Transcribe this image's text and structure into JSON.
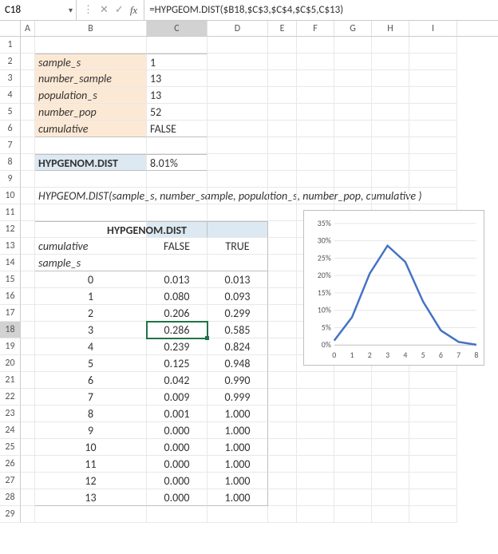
{
  "namebox": "C18",
  "formula": "=HYPGEOM.DIST($B18,$C$3,$C$4,$C$5,C$13)",
  "cols": [
    "A",
    "B",
    "C",
    "D",
    "E",
    "F",
    "G",
    "H",
    "I"
  ],
  "params": {
    "sample_s": {
      "label": "sample_s",
      "value": "1"
    },
    "number_sample": {
      "label": "number_sample",
      "value": "13"
    },
    "population_s": {
      "label": "population_s",
      "value": "13"
    },
    "number_pop": {
      "label": "number_pop",
      "value": "52"
    },
    "cumulative": {
      "label": "cumulative",
      "value": "FALSE"
    }
  },
  "result": {
    "label": "HYPGENOM.DIST",
    "value": "8.01%"
  },
  "syntax": "HYPGEOM.DIST(sample_s, number_sample, population_s, number_pop, cumulative )",
  "table": {
    "header": "HYPGENOM.DIST",
    "row_cum": "cumulative",
    "row_sam": "sample_s",
    "c13": "FALSE",
    "d13": "TRUE",
    "rows": [
      {
        "x": "0",
        "f": "0.013",
        "t": "0.013"
      },
      {
        "x": "1",
        "f": "0.080",
        "t": "0.093"
      },
      {
        "x": "2",
        "f": "0.206",
        "t": "0.299"
      },
      {
        "x": "3",
        "f": "0.286",
        "t": "0.585"
      },
      {
        "x": "4",
        "f": "0.239",
        "t": "0.824"
      },
      {
        "x": "5",
        "f": "0.125",
        "t": "0.948"
      },
      {
        "x": "6",
        "f": "0.042",
        "t": "0.990"
      },
      {
        "x": "7",
        "f": "0.009",
        "t": "0.999"
      },
      {
        "x": "8",
        "f": "0.001",
        "t": "1.000"
      },
      {
        "x": "9",
        "f": "0.000",
        "t": "1.000"
      },
      {
        "x": "10",
        "f": "0.000",
        "t": "1.000"
      },
      {
        "x": "11",
        "f": "0.000",
        "t": "1.000"
      },
      {
        "x": "12",
        "f": "0.000",
        "t": "1.000"
      },
      {
        "x": "13",
        "f": "0.000",
        "t": "1.000"
      }
    ]
  },
  "chart_data": {
    "type": "line",
    "x": [
      0,
      1,
      2,
      3,
      4,
      5,
      6,
      7,
      8
    ],
    "values": [
      0.013,
      0.08,
      0.206,
      0.286,
      0.239,
      0.125,
      0.042,
      0.009,
      0.001
    ],
    "yticks": [
      "0%",
      "5%",
      "10%",
      "15%",
      "20%",
      "25%",
      "30%",
      "35%"
    ],
    "ylim": [
      0,
      0.35
    ],
    "xlabel": "",
    "ylabel": "",
    "title": ""
  },
  "icons": {
    "x": "✕",
    "check": "✓",
    "fx": "fx",
    "dd": "▾",
    "sep": "⋮"
  }
}
